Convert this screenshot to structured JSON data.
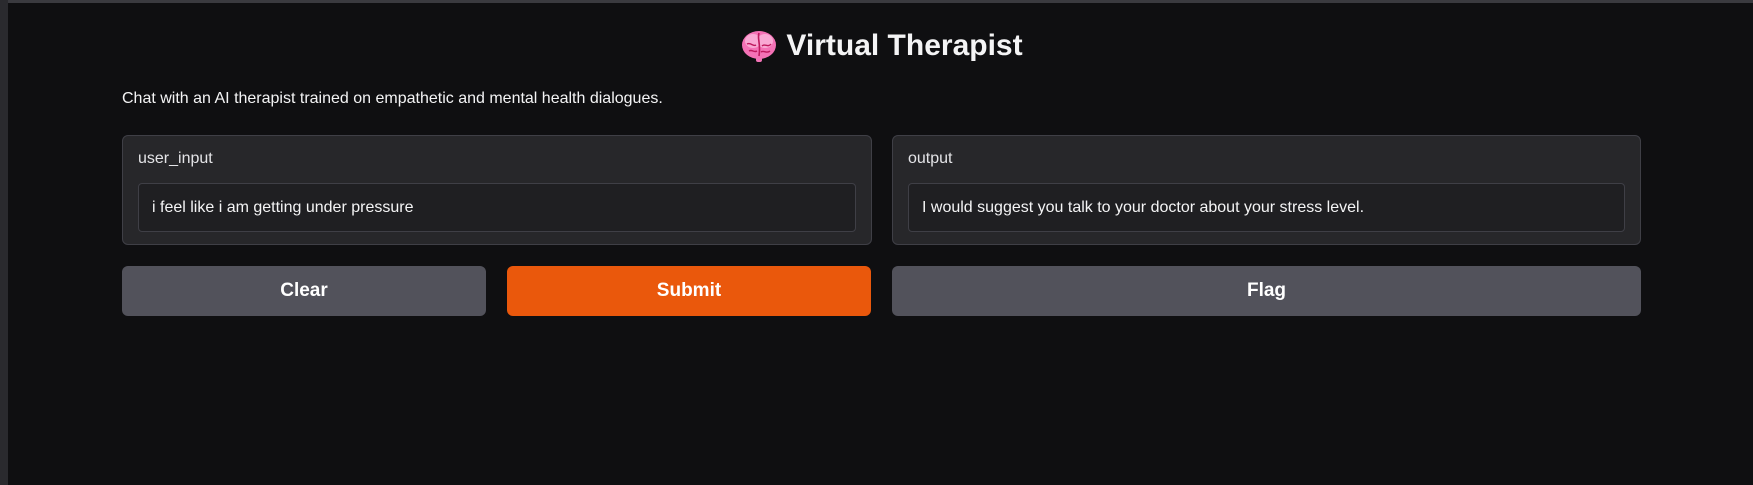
{
  "app": {
    "title": "Virtual Therapist",
    "title_icon": "brain-icon",
    "description": "Chat with an AI therapist trained on empathetic and mental health dialogues."
  },
  "input_panel": {
    "label": "user_input",
    "value": "i feel like i am getting under pressure"
  },
  "output_panel": {
    "label": "output",
    "value": "I would suggest you talk to your doctor about your stress level."
  },
  "buttons": {
    "clear": "Clear",
    "submit": "Submit",
    "flag": "Flag"
  },
  "colors": {
    "background": "#0f0f11",
    "panel": "#27272a",
    "secondary_button": "#52525b",
    "primary_button": "#ea580c",
    "brain_icon": "#f472b6"
  }
}
